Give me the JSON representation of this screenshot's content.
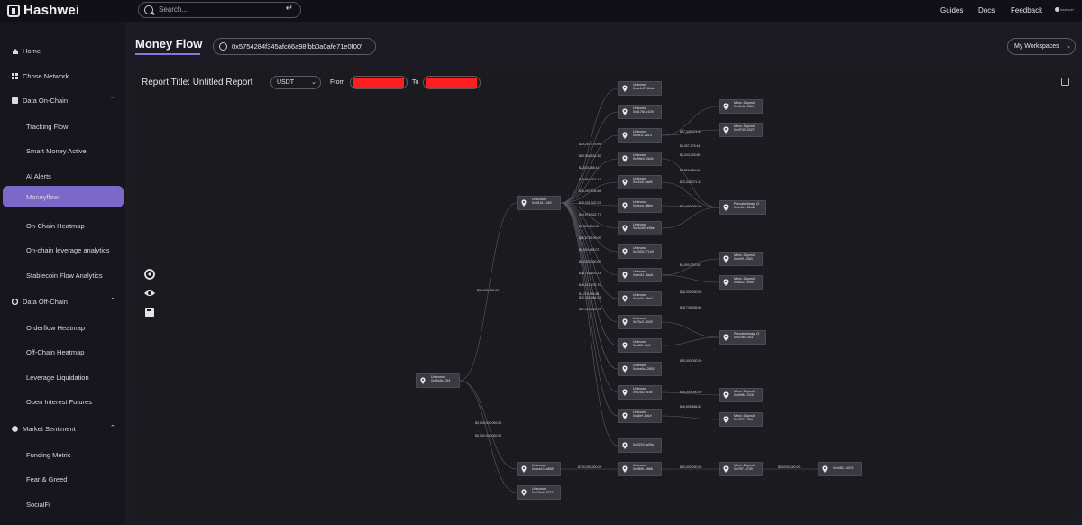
{
  "app": {
    "logo_text": "Hashwei"
  },
  "topbar": {
    "search_placeholder": "Search...",
    "search_enter_glyph": "↵",
    "links": [
      "Guides",
      "Docs",
      "Feedback"
    ],
    "user_label": "hashwei"
  },
  "sidebar": {
    "items": [
      {
        "label": "Home",
        "icon": "home-icon",
        "level": 0
      },
      {
        "label": "Chose Network",
        "icon": "grid-icon",
        "level": 0
      },
      {
        "label": "Data On-Chain",
        "icon": "database-icon",
        "level": 0,
        "expanded": true
      },
      {
        "label": "Tracking Flow",
        "level": 1
      },
      {
        "label": "Smart Money Active",
        "level": 1
      },
      {
        "label": "AI Alerts",
        "level": 1
      },
      {
        "label": "Moneyflow",
        "level": 1,
        "active": true
      },
      {
        "label": "On-Chain Heatmap",
        "level": 1
      },
      {
        "label": "On-chain leverage analytics",
        "level": 1
      },
      {
        "label": "Stablecoin Flow Analytics",
        "level": 1
      },
      {
        "label": "Data Off-Chain",
        "icon": "settings-icon",
        "level": 0,
        "expanded": true
      },
      {
        "label": "Orderflow Heatmap",
        "level": 1
      },
      {
        "label": "Off-Chain Heatmap",
        "level": 1
      },
      {
        "label": "Leverage Liquidation",
        "level": 1
      },
      {
        "label": "Open Interest Futures",
        "level": 1
      },
      {
        "label": "Market Sentiment",
        "icon": "sentiment-icon",
        "level": 0,
        "expanded": true
      },
      {
        "label": "Funding Metric",
        "level": 1
      },
      {
        "label": "Fear & Greed",
        "level": 1
      },
      {
        "label": "SocialFi",
        "level": 1
      }
    ]
  },
  "header": {
    "title": "Money Flow",
    "address": "0x5754284f345afc66a98fbb0a0afe71e0f00'",
    "workspace_label": "My Workspaces"
  },
  "report": {
    "title": "Report Title: Untitled Report",
    "token": "USDT",
    "from_label": "From",
    "to_label": "To"
  },
  "colors": {
    "accent": "#7c68c8",
    "redaction": "#ff1e1e",
    "node_bg": "#3a3a43"
  },
  "graph": {
    "nodes": [
      {
        "id": "n0",
        "l1": "Unknown",
        "l2": "0xb3c6c..f2f4"
      },
      {
        "id": "n1",
        "l1": "Unknown",
        "l2": "0x5f1b1..f262"
      },
      {
        "id": "n2",
        "l1": "Unknown",
        "l2": "0xaca13..a858"
      },
      {
        "id": "n3",
        "l1": "Unknown",
        "l2": "0xe7bc6..8772"
      },
      {
        "id": "a1",
        "l1": "Unknown",
        "l2": "0xac1d7..4bde"
      },
      {
        "id": "a2",
        "l1": "Unknown",
        "l2": "0xd17f8..c109"
      },
      {
        "id": "a3",
        "l1": "Unknown",
        "l2": "0x8f18..2814"
      },
      {
        "id": "a4",
        "l1": "Unknown",
        "l2": "0xf99e0..0b2e"
      },
      {
        "id": "a5",
        "l1": "Unknown",
        "l2": "0xe2c8..0a06"
      },
      {
        "id": "a6",
        "l1": "Unknown",
        "l2": "0x5eca..d8bd"
      },
      {
        "id": "a7",
        "l1": "Unknown",
        "l2": "0xeb4d0..e06e"
      },
      {
        "id": "a8",
        "l1": "Unknown",
        "l2": "0x23f32..71b9"
      },
      {
        "id": "a9",
        "l1": "Unknown",
        "l2": "0xfe411..3ad1"
      },
      {
        "id": "a10",
        "l1": "Unknown",
        "l2": "0x7a04..0be2"
      },
      {
        "id": "a11",
        "l1": "Unknown",
        "l2": "0x73c3..3028"
      },
      {
        "id": "a12",
        "l1": "Unknown",
        "l2": "0xaf80..4fa7"
      },
      {
        "id": "a13",
        "l1": "Unknown",
        "l2": "0x6ee6c..2892"
      },
      {
        "id": "a14",
        "l1": "Unknown",
        "l2": "0xf1402..f1bc"
      },
      {
        "id": "a15",
        "l1": "Unknown",
        "l2": "0xa8ef..8d1e"
      },
      {
        "id": "a16",
        "l1": "",
        "l2": "0xf0224..a05a"
      },
      {
        "id": "a17",
        "l1": "Unknown",
        "l2": "0x3f6f9..e868"
      },
      {
        "id": "b1",
        "l1": "Mexc: Deposit",
        "l2": "0x00e8..a364"
      },
      {
        "id": "b2",
        "l1": "Mexc: Deposit",
        "l2": "0x9f730..0327"
      },
      {
        "id": "b3",
        "l1": "PancakeSwap V2",
        "l2": "0x0e3e..f61a8"
      },
      {
        "id": "b4",
        "l1": "Mexc: Deposit",
        "l2": "0xfe09..4083"
      },
      {
        "id": "b5",
        "l1": "Mexc: Deposit",
        "l2": "0x8632..0955"
      },
      {
        "id": "b6",
        "l1": "PancakeSwap V2",
        "l2": "0x4OcB..3f21"
      },
      {
        "id": "b7",
        "l1": "Mexc: Deposit",
        "l2": "0x8f4fb..0228"
      },
      {
        "id": "b8",
        "l1": "Mexc: Deposit",
        "l2": "0x7377..78fd"
      },
      {
        "id": "c1",
        "l1": "Mexc: Deposit",
        "l2": "0x70f7..d705"
      },
      {
        "id": "d1",
        "l1": "",
        "l2": "0x4082..49C9"
      }
    ],
    "edges": [
      {
        "from": "n0",
        "to": "n1",
        "label": "$30,000,000.00"
      },
      {
        "from": "n0",
        "to": "n2",
        "label": "$2,000,000,000.00"
      },
      {
        "from": "n0",
        "to": "n3",
        "label": "$6,000,000,000.00"
      },
      {
        "from": "n1",
        "to": "a1",
        "label": ""
      },
      {
        "from": "n1",
        "to": "a2",
        "label": ""
      },
      {
        "from": "n1",
        "to": "a3",
        "label": "$30,287,775.99"
      },
      {
        "from": "n1",
        "to": "a4",
        "label": "$60,364,631.30"
      },
      {
        "from": "n1",
        "to": "a5",
        "label": "$2,634,288.41"
      },
      {
        "from": "n1",
        "to": "a6",
        "label": "$29,964,071.41"
      },
      {
        "from": "n1",
        "to": "a7",
        "label": "$76,497,635.46"
      },
      {
        "from": "n1",
        "to": "a8",
        "label": "$30,331,322.22"
      },
      {
        "from": "n1",
        "to": "a9",
        "label": "$44,976,322.77"
      },
      {
        "from": "n1",
        "to": "a10",
        "label": "$4,050,000.00"
      },
      {
        "from": "n1",
        "to": "a11",
        "label": "$26,578,109.00"
      },
      {
        "from": "n1",
        "to": "a12",
        "label": "$4,000,465.07"
      },
      {
        "from": "n1",
        "to": "a13",
        "label": "$30,000,000.00"
      },
      {
        "from": "n1",
        "to": "a14",
        "label": "$38,744,202.23"
      },
      {
        "from": "n1",
        "to": "a15",
        "label": "$46,312,476.70"
      },
      {
        "from": "n1",
        "to": "a16",
        "label": "$4,215,484.88"
      },
      {
        "from": "n1",
        "to": "a12",
        "label": "$10,326,984.93"
      },
      {
        "from": "n1",
        "to": "a13",
        "label": "$32,394,415.73"
      },
      {
        "from": "a3",
        "to": "b1",
        "label": "$57,349,071.41"
      },
      {
        "from": "a3",
        "to": "b2",
        "label": "$2,007,775.44"
      },
      {
        "from": "a4",
        "to": "b3",
        "label": "$2,343,228.80"
      },
      {
        "from": "a5",
        "to": "b3",
        "label": "$5,825,288.41"
      },
      {
        "from": "a6",
        "to": "b3",
        "label": "$33,348,071.41"
      },
      {
        "from": "a7",
        "to": "b3",
        "label": "$21,000,000.00"
      },
      {
        "from": "a9",
        "to": "b4",
        "label": "$4,000,000.00"
      },
      {
        "from": "a9",
        "to": "b5",
        "label": "$26,000,000.00"
      },
      {
        "from": "a11",
        "to": "b6",
        "label": "$38,745,535.89"
      },
      {
        "from": "a12",
        "to": "b6",
        "label": "$50,000,000.00"
      },
      {
        "from": "a14",
        "to": "b7",
        "label": "$45,000,000.00"
      },
      {
        "from": "a15",
        "to": "b8",
        "label": "$46,505,584.62"
      },
      {
        "from": "n2",
        "to": "a17",
        "label": "$750,000,000.00"
      },
      {
        "from": "a17",
        "to": "c1",
        "label": "$50,000,000.00"
      },
      {
        "from": "c1",
        "to": "d1",
        "label": "$50,000,000.00"
      }
    ]
  }
}
